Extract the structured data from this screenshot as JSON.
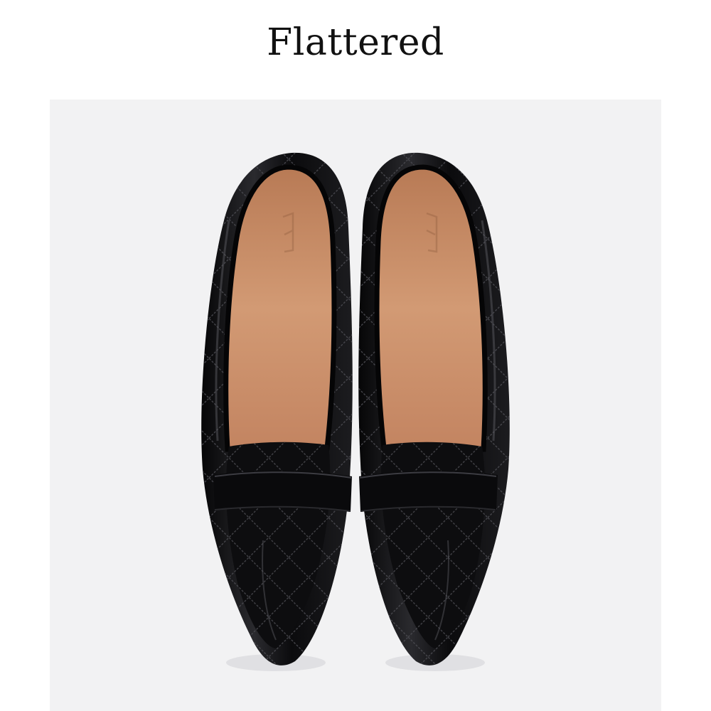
{
  "brand": {
    "name": "Flattered"
  },
  "product_image": {
    "subject": "pair-of-black-quilted-pointed-loafers",
    "colors": {
      "background": "#f2f2f3",
      "leather": "#0e0e10",
      "leather_highlight": "#3a3a3e",
      "lining": "#c98f69",
      "lining_shadow": "#a8704d"
    }
  }
}
